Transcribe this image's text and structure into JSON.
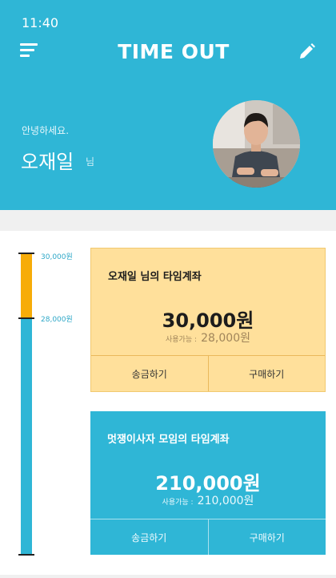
{
  "status_bar": {
    "time": "11:40"
  },
  "header": {
    "title": "TIME OUT",
    "menu_icon": "hamburger-menu-icon",
    "edit_icon": "pencil-icon",
    "background": "#2fb6d6"
  },
  "profile": {
    "greeting": "안녕하세요.",
    "name": "오재일",
    "suffix": "님"
  },
  "balance_gauge": {
    "labels": [
      "30,000원",
      "28,000원"
    ],
    "available_fraction": 0.79,
    "used_color": "#f7ac08",
    "available_color": "#2fb6d6"
  },
  "accounts": [
    {
      "title": "오재일 님의 타임계좌",
      "amount": "30,000원",
      "available_label": "사용가능 :",
      "available_value": "28,000원",
      "transfer_label": "송금하기",
      "purchase_label": "구매하기",
      "color": "#ffe09b"
    },
    {
      "title": "멋쟁이사자 모임의 타임계좌",
      "amount": "210,000원",
      "available_label": "사용가능 :",
      "available_value": "210,000원",
      "transfer_label": "송금하기",
      "purchase_label": "구매하기",
      "color": "#2fb6d6"
    }
  ]
}
